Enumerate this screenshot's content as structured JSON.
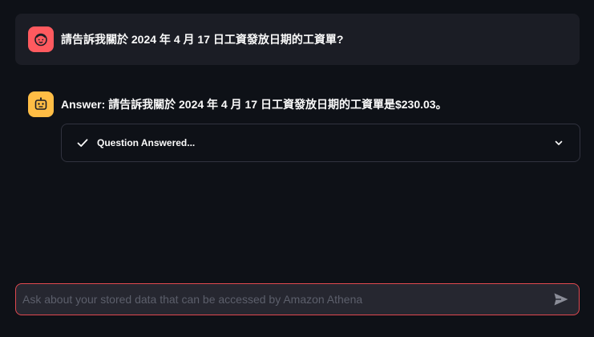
{
  "user_message": {
    "text": "請告訴我關於 2024 年 4 月 17 日工資發放日期的工資單?",
    "avatar_icon": "user-face-icon",
    "avatar_color": "#ff5a5f"
  },
  "assistant_message": {
    "text": "Answer: 請告訴我關於 2024 年 4 月 17 日工資發放日期的工資單是$230.03。",
    "avatar_icon": "robot-icon",
    "avatar_color": "#ffbd45",
    "status": {
      "label": "Question Answered...",
      "state_icon": "check-icon",
      "expand_icon": "chevron-down-icon"
    }
  },
  "chat_input": {
    "placeholder": "Ask about your stored data that can be accessed by Amazon Athena",
    "value": "",
    "send_icon": "send-icon",
    "border_color": "#e0484f"
  }
}
